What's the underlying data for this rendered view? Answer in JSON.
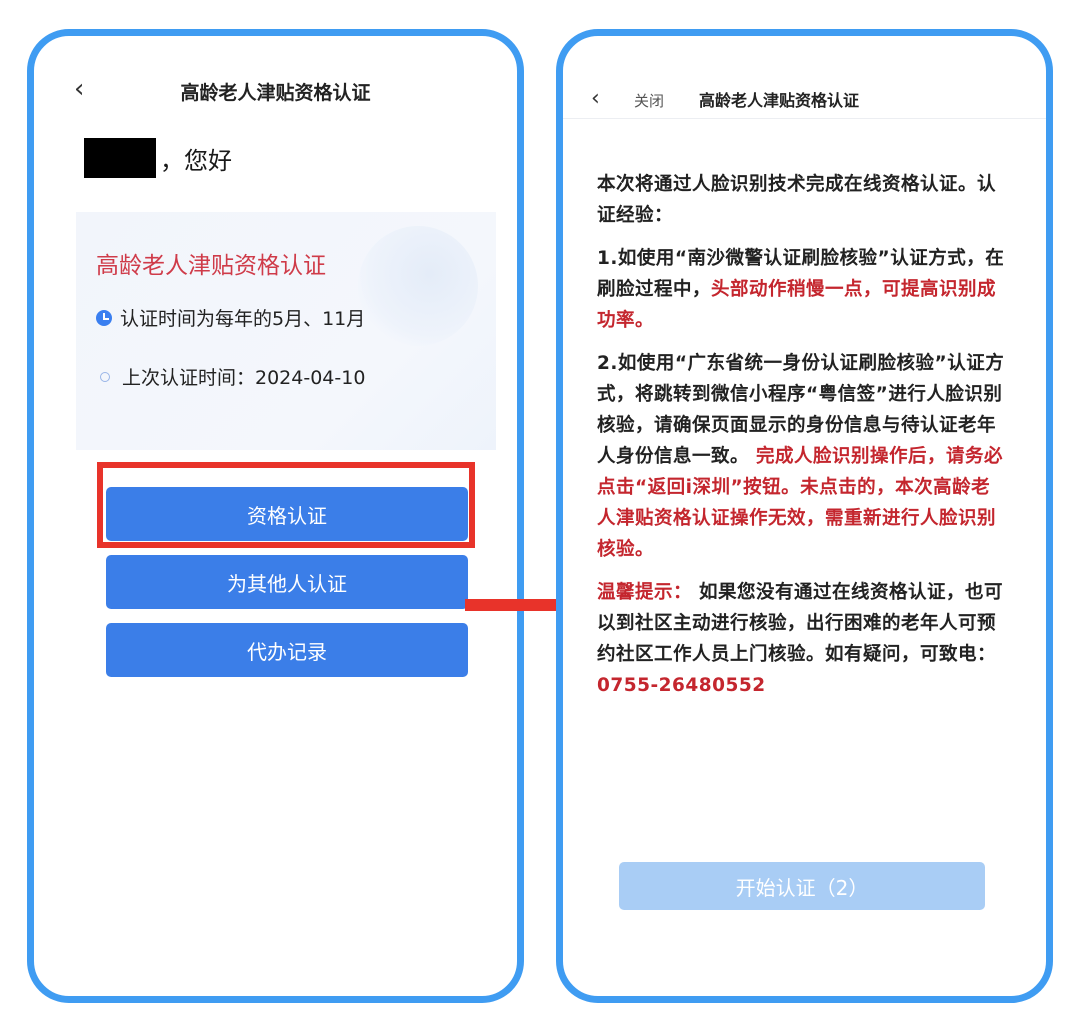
{
  "left_screen": {
    "back_icon": "chevron-left-icon",
    "title": "高龄老人津贴资格认证",
    "greeting": "，您好",
    "card": {
      "title": "高龄老人津贴资格认证",
      "schedule": "认证时间为每年的5月、11月",
      "last_time": "上次认证时间：2024-04-10"
    },
    "buttons": {
      "qualification": "资格认证",
      "others": "为其他人认证",
      "records": "代办记录"
    }
  },
  "right_screen": {
    "back_icon": "chevron-left-icon",
    "close_label": "关闭",
    "title": "高龄老人津贴资格认证",
    "intro": "本次将通过人脸识别技术完成在线资格认证。认证经验：",
    "item1_a": "1.如使用“南沙微警认证刷脸核验”认证方式，在刷脸过程中，",
    "item1_b": "头部动作稍慢一点，可提高识别成功率。",
    "item2_a": "2.如使用“广东省统一身份认证刷脸核验”认证方式，将跳转到微信小程序“粤信签”进行人脸识别核验，请确保页面显示的身份信息与待认证老年人身份信息一致。",
    "item2_b": "完成人脸识别操作后，请务必点击“返回i深圳”按钮。未点击的，本次高龄老人津贴资格认证操作无效，需重新进行人脸识别核验。",
    "tip_label": "温馨提示：",
    "tip_text": "如果您没有通过在线资格认证，也可以到社区主动进行核验，出行困难的老年人可预约社区工作人员上门核验。如有疑问，可致电：",
    "phone": "0755-26480552",
    "start_button": "开始认证（2）"
  },
  "colors": {
    "phone_border": "#3f9cf2",
    "primary_button": "#3b7ee8",
    "disabled_button": "#a9cdf5",
    "highlight": "#e8332a",
    "accent_red": "#c4262e"
  }
}
